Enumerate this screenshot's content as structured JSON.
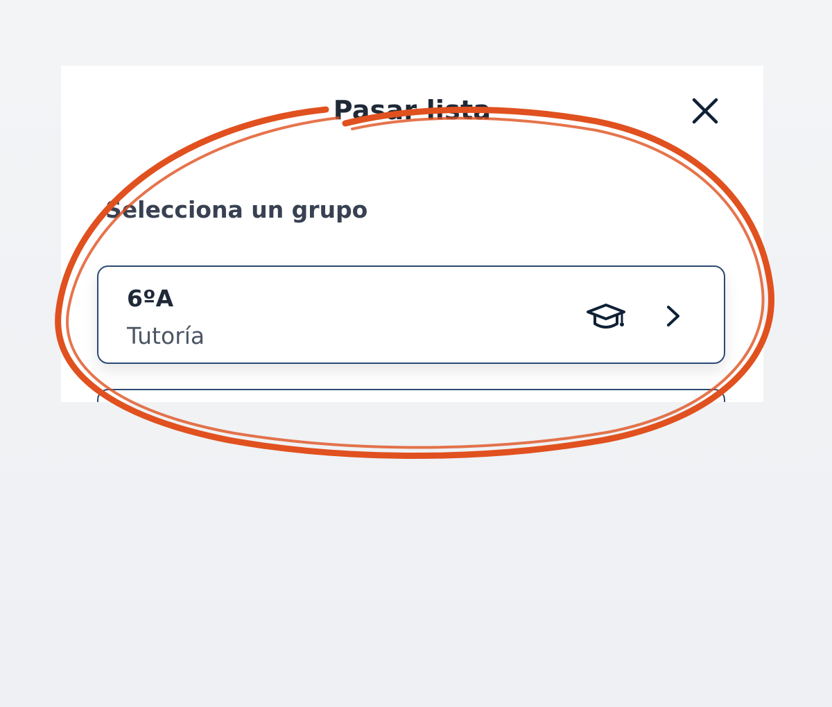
{
  "sheet": {
    "title": "Pasar lista",
    "close_icon": "close-icon"
  },
  "section": {
    "label": "Selecciona un grupo"
  },
  "groups": [
    {
      "name": "6ºA",
      "role": "Tutoría",
      "icon": "graduation-cap-icon",
      "action_icon": "chevron-right-icon"
    }
  ],
  "colors": {
    "card_border": "#2b4a72",
    "icon": "#0f2136",
    "annotation": "#e0511f"
  }
}
